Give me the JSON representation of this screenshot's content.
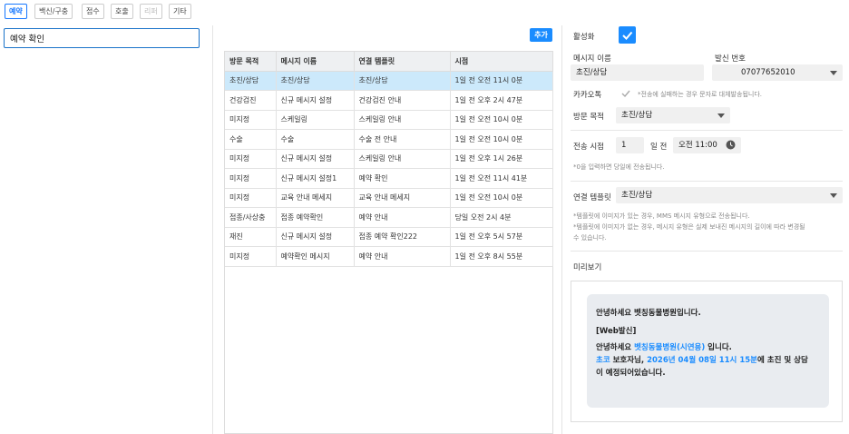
{
  "tabs": [
    {
      "label": "예약",
      "state": "active"
    },
    {
      "label": "백신/구충",
      "state": "normal"
    },
    {
      "label": "접수",
      "state": "normal"
    },
    {
      "label": "호출",
      "state": "normal"
    },
    {
      "label": "리퍼",
      "state": "disabled"
    },
    {
      "label": "기타",
      "state": "normal"
    }
  ],
  "left": {
    "selected_item": "예약 확인"
  },
  "toolbar": {
    "add_label": "추가"
  },
  "table": {
    "headers": [
      "방문 목적",
      "메시지 이름",
      "연결 템플릿",
      "시점"
    ],
    "rows": [
      [
        "초진/상담",
        "초진/상담",
        "초진/상담",
        "1일 전 오전 11시 0분"
      ],
      [
        "건강검진",
        "신규 메시지 설정",
        "건강검진 안내",
        "1일 전 오후 2시 47분"
      ],
      [
        "미지정",
        "스케일링",
        "스케일링 안내",
        "1일 전 오전 10시 0분"
      ],
      [
        "수술",
        "수술",
        "수술 전 안내",
        "1일 전 오전 10시 0분"
      ],
      [
        "미지정",
        "신규 메시지 설정",
        "스케일링 안내",
        "1일 전 오후 1시 26분"
      ],
      [
        "미지정",
        "신규 메시지 설정1",
        "예약 확인",
        "1일 전 오전 11시 41분"
      ],
      [
        "미지정",
        "교육 안내 메세지",
        "교육 안내 메세지",
        "1일 전 오전 10시 0분"
      ],
      [
        "접종/사상충",
        "접종 예약확인",
        "예약 안내",
        "당일 오전 2시 4분"
      ],
      [
        "재진",
        "신규 메시지 설정",
        "접종 예약 확인222",
        "1일 전 오후 5시 57분"
      ],
      [
        "미지정",
        "예약확인 메시지",
        "예약 안내",
        "1일 전 오후 8시 55분"
      ]
    ],
    "selected_row": 0
  },
  "form": {
    "active_label": "활성화",
    "message_name_label": "메시지 이름",
    "message_name_value": "초진/상담",
    "sender_label": "발신 번호",
    "sender_value": "07077652010",
    "kakao_label": "카카오톡",
    "kakao_hint": "*전송에 실패하는 경우 문자로 대체발송됩니다.",
    "purpose_label": "방문 목적",
    "purpose_value": "초진/상담",
    "send_time_label": "전송 시점",
    "send_time_days": "1",
    "send_time_unit": "일 전",
    "send_time_value": "오전 11:00",
    "send_time_hint": "*0을 입력하면 당일에 전송됩니다.",
    "template_label": "연결 템플릿",
    "template_value": "초진/상담",
    "template_hint_1": "*템플릿에 이미지가 있는 경우, MMS 메시지 유형으로 전송됩니다.",
    "template_hint_2": "*템플릿에 이미지가 없는 경우, 메시지 유형은 실제 보내진 메시지의 길이에 따라 변경될",
    "template_hint_3": "수 있습니다.",
    "preview_label": "미리보기"
  },
  "preview": {
    "line1": "안녕하세요 벳칭동물병원입니다.",
    "line2": "[Web발신]",
    "line3_prefix": "안녕하세요 ",
    "line3_hospital": "벳칭동물병원(시연용)",
    "line3_suffix": " 입니다.",
    "line4_name": "초코",
    "line4_mid": " 보호자님, ",
    "line4_date": "2026년 04월 08일 11시 15분",
    "line4_suffix": "에 초진 및 상담",
    "line5": "이 예정되어있습니다."
  },
  "colors": {
    "accent": "#1a8cff",
    "selected_row": "#cce9fb",
    "input_border": "#1a73c9"
  }
}
